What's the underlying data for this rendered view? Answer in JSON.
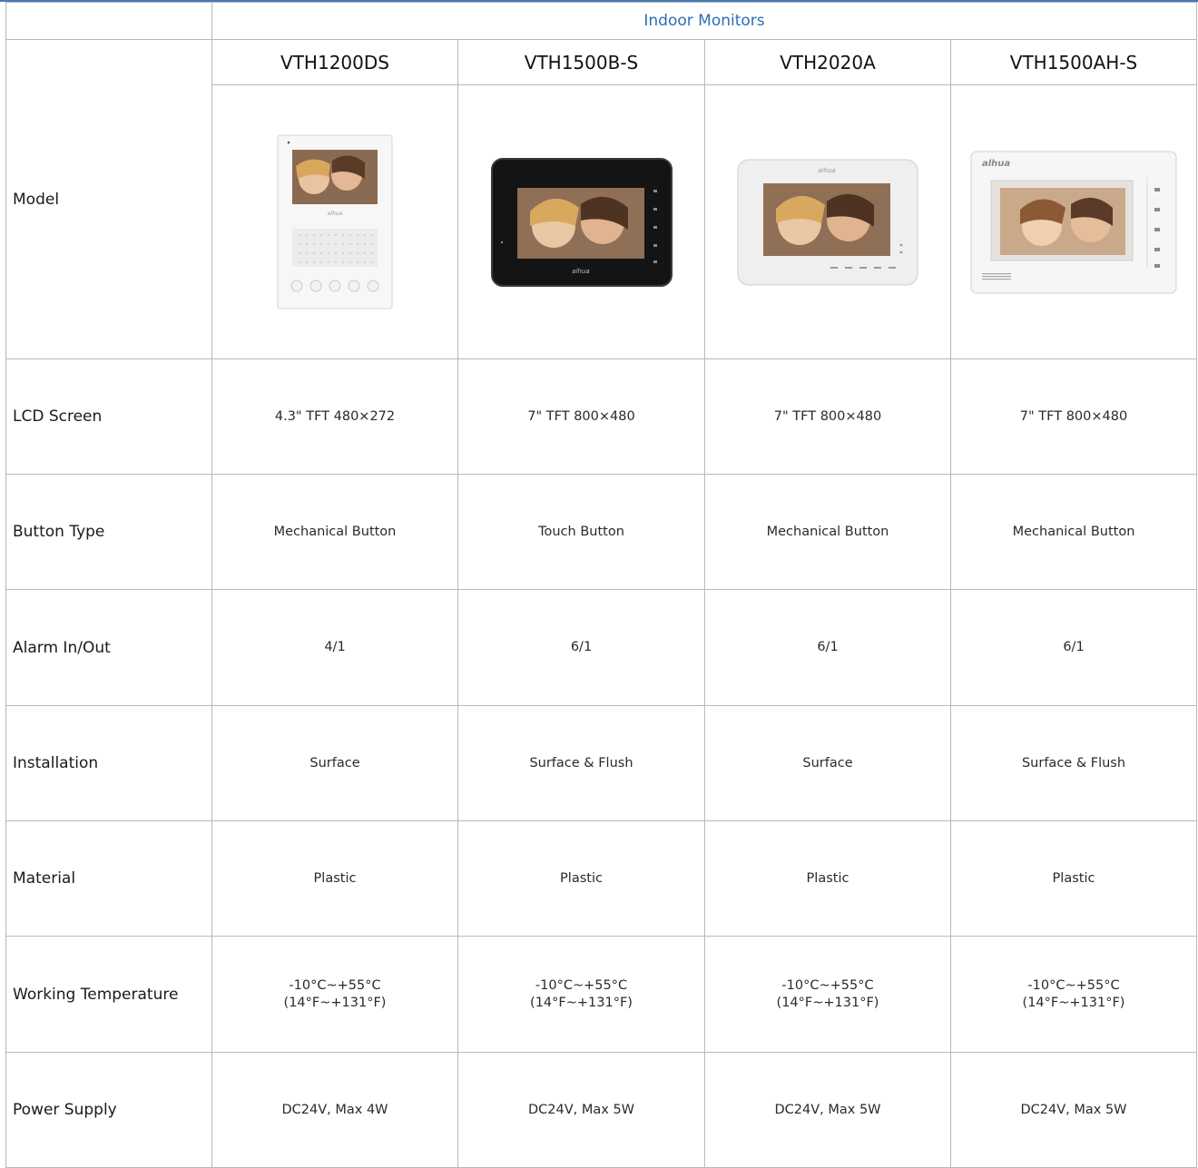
{
  "section_header": "Indoor Monitors",
  "models": [
    "VTH1200DS",
    "VTH1500B-S",
    "VTH2020A",
    "VTH1500AH-S"
  ],
  "brand": "alhua",
  "rows": [
    {
      "label": "Model"
    },
    {
      "label": "LCD Screen",
      "values": [
        "4.3\" TFT 480×272",
        "7\" TFT 800×480",
        "7\" TFT 800×480",
        "7\" TFT 800×480"
      ]
    },
    {
      "label": "Button Type",
      "values": [
        "Mechanical Button",
        "Touch Button",
        "Mechanical Button",
        "Mechanical Button"
      ]
    },
    {
      "label": "Alarm In/Out",
      "values": [
        "4/1",
        "6/1",
        "6/1",
        "6/1"
      ]
    },
    {
      "label": "Installation",
      "values": [
        "Surface",
        "Surface & Flush",
        "Surface",
        "Surface & Flush"
      ]
    },
    {
      "label": "Material",
      "values": [
        "Plastic",
        "Plastic",
        "Plastic",
        "Plastic"
      ]
    },
    {
      "label": "Working Temperature",
      "values": [
        {
          "line1": "-10°C~+55°C",
          "line2": "(14°F~+131°F)"
        },
        {
          "line1": "-10°C~+55°C",
          "line2": "(14°F~+131°F)"
        },
        {
          "line1": "-10°C~+55°C",
          "line2": "(14°F~+131°F)"
        },
        {
          "line1": "-10°C~+55°C",
          "line2": "(14°F~+131°F)"
        }
      ]
    },
    {
      "label": "Power Supply",
      "values": [
        "DC24V, Max 4W",
        "DC24V, Max 5W",
        "DC24V, Max 5W",
        "DC24V, Max 5W"
      ]
    }
  ],
  "colors": {
    "header_text": "#2f6db5",
    "border": "#b9b9b9",
    "top_rule": "#4a78b8"
  }
}
